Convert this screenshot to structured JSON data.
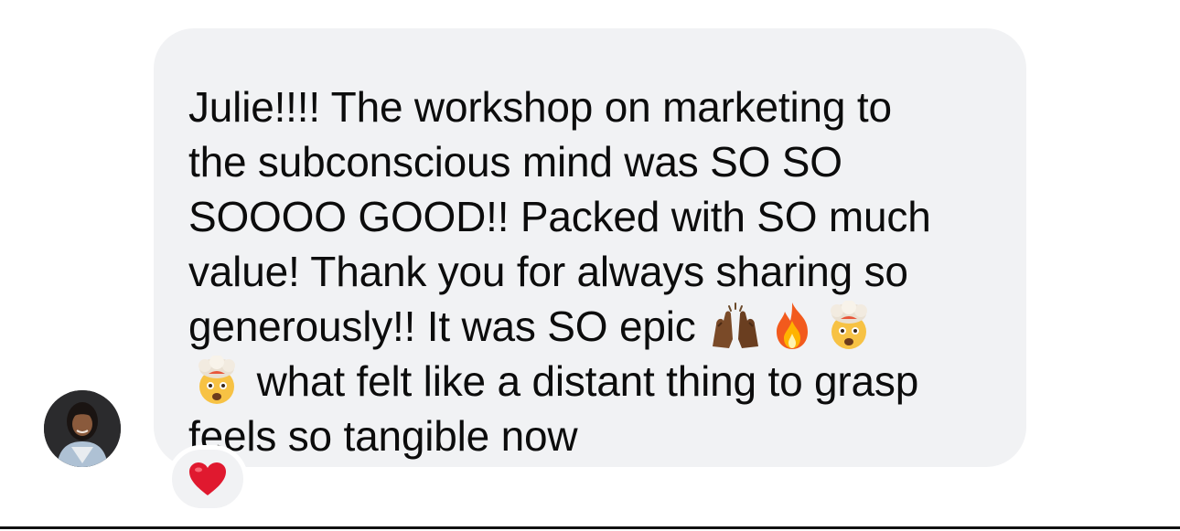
{
  "message": {
    "line1": "Julie!!!! The workshop on marketing to",
    "line2": "the subconscious mind was SO SO",
    "line3": "SOOOO GOOD!! Packed with SO much",
    "line4": "value! Thank you for always sharing so",
    "line5": "generously!! It was SO epic",
    "line6": "what felt like a distant thing to grasp",
    "line7": "feels so tangible now"
  },
  "emojis": [
    "raising-hands-icon",
    "fire-icon",
    "exploding-head-icon",
    "exploding-head-icon"
  ],
  "reaction": {
    "icon": "heart-icon",
    "color": "#e0192f"
  },
  "colors": {
    "bubble": "#f1f2f4",
    "text": "#0c0c0c",
    "background": "#ffffff"
  }
}
